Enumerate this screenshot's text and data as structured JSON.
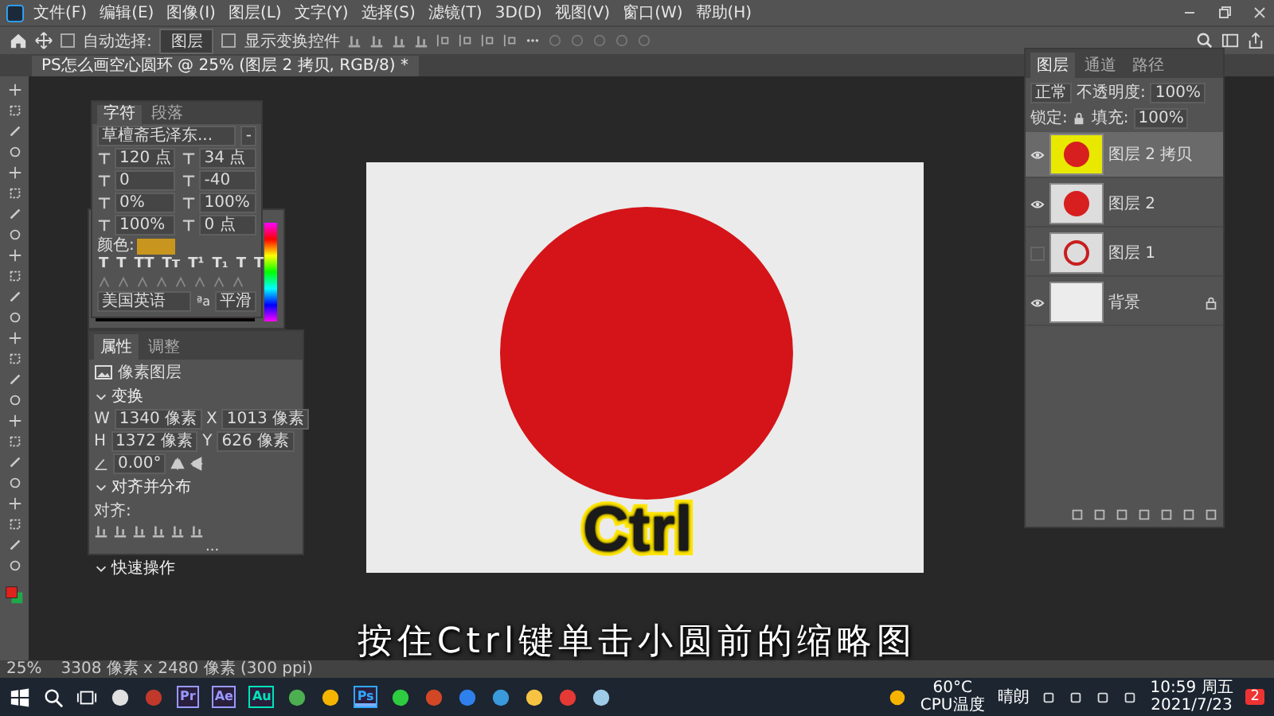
{
  "menu_bar": {
    "items": [
      "文件(F)",
      "编辑(E)",
      "图像(I)",
      "图层(L)",
      "文字(Y)",
      "选择(S)",
      "滤镜(T)",
      "3D(D)",
      "视图(V)",
      "窗口(W)",
      "帮助(H)"
    ]
  },
  "options_bar": {
    "auto_select_label": "自动选择:",
    "auto_select_checked": false,
    "target": "图层",
    "show_transform_label": "显示变换控件",
    "show_transform_checked": false
  },
  "document_tab": {
    "title": "PS怎么画空心圆环 @ 25% (图层 2 拷贝, RGB/8) *"
  },
  "character_panel": {
    "tabs": [
      {
        "label": "字符",
        "selected": true
      },
      {
        "label": "段落",
        "selected": false
      }
    ],
    "font": "草檀斋毛泽东...",
    "style": "-",
    "fields": [
      "120 点",
      "34 点",
      "0",
      "-40",
      "0%",
      "100%",
      "100%",
      "0 点"
    ],
    "color_label": "颜色:",
    "color": "#c8961e",
    "style_buttons": [
      "T",
      "T",
      "TT",
      "Tт",
      "T¹",
      "T₁",
      "T",
      "T"
    ],
    "language": "美国英语",
    "antialias_label": "ªa",
    "antialias": "平滑"
  },
  "properties_panel": {
    "tabs": [
      {
        "label": "属性",
        "selected": true
      },
      {
        "label": "调整",
        "selected": false
      }
    ],
    "layer_type": "像素图层",
    "transform": {
      "title": "变换",
      "expanded": true,
      "w_label": "W",
      "w": "1340 像素",
      "x_label": "X",
      "x": "1013 像素",
      "h_label": "H",
      "h": "1372 像素",
      "y_label": "Y",
      "y": "626 像素",
      "angle": "0.00°"
    },
    "align": {
      "title": "对齐并分布",
      "expanded": true,
      "label": "对齐:",
      "more": "..."
    },
    "quick_actions": {
      "title": "快速操作",
      "expanded": true
    }
  },
  "layers_panel": {
    "tabs": [
      {
        "label": "图层",
        "selected": true
      },
      {
        "label": "通道",
        "selected": false
      },
      {
        "label": "路径",
        "selected": false
      }
    ],
    "blend_mode": "正常",
    "opacity_label": "不透明度:",
    "opacity": "100%",
    "lock_label": "锁定:",
    "fill_label": "填充:",
    "fill": "100%",
    "layers": [
      {
        "name": "图层 2 拷贝",
        "kind": "disc",
        "visible": true,
        "selected": true,
        "highlighted": true,
        "locked": false
      },
      {
        "name": "图层 2",
        "kind": "disc",
        "visible": true,
        "selected": false,
        "highlighted": false,
        "locked": false
      },
      {
        "name": "图层 1",
        "kind": "ring",
        "visible": false,
        "selected": false,
        "highlighted": false,
        "locked": false
      },
      {
        "name": "背景",
        "kind": "plain",
        "visible": true,
        "selected": false,
        "highlighted": false,
        "locked": true
      }
    ]
  },
  "canvas": {
    "overlay_text": "Ctrl"
  },
  "subtitle": "按住Ctrl键单击小圆前的缩略图",
  "status_bar": {
    "zoom": "25%",
    "info": "3308 像素 x 2480 像素 (300 ppi)"
  },
  "taskbar": {
    "apps": [
      {
        "kind": "glyph",
        "color": "#e0e0e0",
        "active": false
      },
      {
        "kind": "glyph",
        "color": "#c0392b",
        "active": false
      },
      {
        "kind": "letter",
        "label": "Pr",
        "color": "#9999ff",
        "active": false
      },
      {
        "kind": "letter",
        "label": "Ae",
        "color": "#9999ff",
        "active": false
      },
      {
        "kind": "letter",
        "label": "Au",
        "color": "#00e4bb",
        "active": false
      },
      {
        "kind": "glyph",
        "color": "#4caf50",
        "active": false
      },
      {
        "kind": "glyph",
        "color": "#f4b400",
        "active": false
      },
      {
        "kind": "letter",
        "label": "Ps",
        "color": "#31a8ff",
        "active": true
      },
      {
        "kind": "glyph",
        "color": "#2ecc40",
        "active": false
      },
      {
        "kind": "glyph",
        "color": "#d24726",
        "active": false
      },
      {
        "kind": "glyph",
        "color": "#2f80ed",
        "active": false
      },
      {
        "kind": "glyph",
        "color": "#3a9bdc",
        "active": false
      },
      {
        "kind": "glyph",
        "color": "#f6c342",
        "active": false
      },
      {
        "kind": "glyph",
        "color": "#e53935",
        "active": false
      },
      {
        "kind": "glyph",
        "color": "#9ecbe8",
        "active": false
      }
    ],
    "temp": "60°C",
    "temp_label": "CPU温度",
    "weather": "晴朗",
    "time": "10:59 周五",
    "date": "2021/7/23",
    "notifications": "2"
  }
}
